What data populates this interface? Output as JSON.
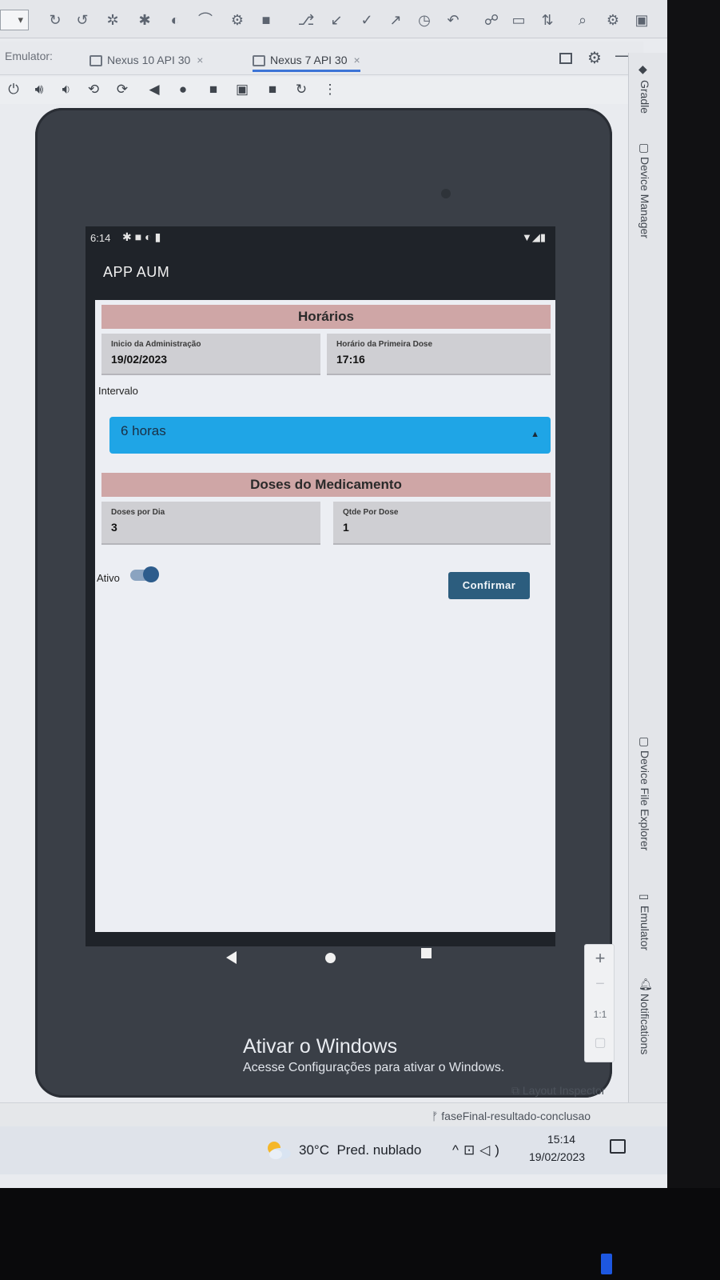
{
  "ide": {
    "emulator_label": "Emulator:",
    "tabs": [
      {
        "label": "Nexus 10 API 30",
        "close": "×",
        "active": false
      },
      {
        "label": "Nexus 7 API 30",
        "close": "×",
        "active": true
      }
    ],
    "side_panel": {
      "gradle": "Gradle",
      "device_manager": "Device Manager",
      "device_file_explorer": "Device File Explorer",
      "emulator": "Emulator",
      "notifications": "Notifications"
    },
    "zoom": {
      "plus": "+",
      "minus": "−",
      "ratio": "1:1"
    },
    "layout_inspector": "Layout Inspector",
    "branch": "faseFinal-resultado-conclusao"
  },
  "phone": {
    "status_time": "6:14",
    "app_title": "APP AUM",
    "horarios": {
      "header": "Horários",
      "inicio_label": "Inicio da Administração",
      "inicio_value": "19/02/2023",
      "primeira_dose_label": "Horário da Primeira Dose",
      "primeira_dose_value": "17:16"
    },
    "intervalo": {
      "label": "Intervalo",
      "selected": "6 horas"
    },
    "doses": {
      "header": "Doses do Medicamento",
      "doses_dia_label": "Doses por Dia",
      "doses_dia_value": "3",
      "qtde_label": "Qtde Por Dose",
      "qtde_value": "1"
    },
    "ativo_label": "Ativo",
    "ativo_on": true,
    "confirm_label": "Confirmar"
  },
  "watermark": {
    "title": "Ativar o Windows",
    "subtitle": "Acesse Configurações para ativar o Windows."
  },
  "taskbar": {
    "temperature": "30°C",
    "weather": "Pred. nublado",
    "time": "15:14",
    "date": "19/02/2023"
  },
  "colors": {
    "section_header": "#cfa6a6",
    "dropdown": "#1fa5e6",
    "confirm_button": "#2c5d7e",
    "switch_thumb": "#2d5c8c"
  }
}
